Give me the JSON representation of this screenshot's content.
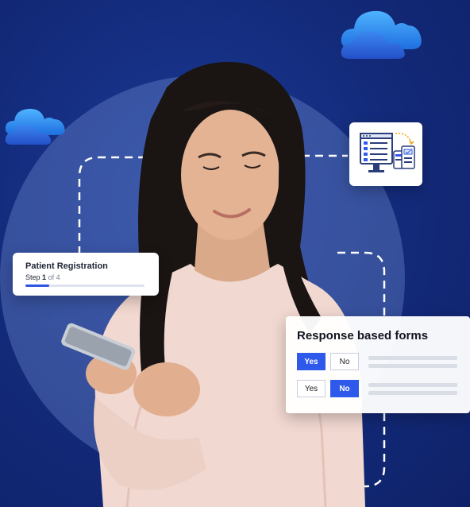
{
  "registration": {
    "title": "Patient Registration",
    "step_word": "Step",
    "step_current": "1",
    "step_of": "of 4",
    "progress_fraction": 0.2
  },
  "response_forms": {
    "title": "Response based forms",
    "rows": [
      {
        "yes_label": "Yes",
        "no_label": "No",
        "selected": "yes"
      },
      {
        "yes_label": "Yes",
        "no_label": "No",
        "selected": "no"
      }
    ]
  },
  "colors": {
    "background": "#132a7a",
    "accent": "#2f59ea",
    "cloud": "#2f8ff0"
  },
  "icons": [
    "cloud-icon",
    "multi-device-forms-icon"
  ]
}
